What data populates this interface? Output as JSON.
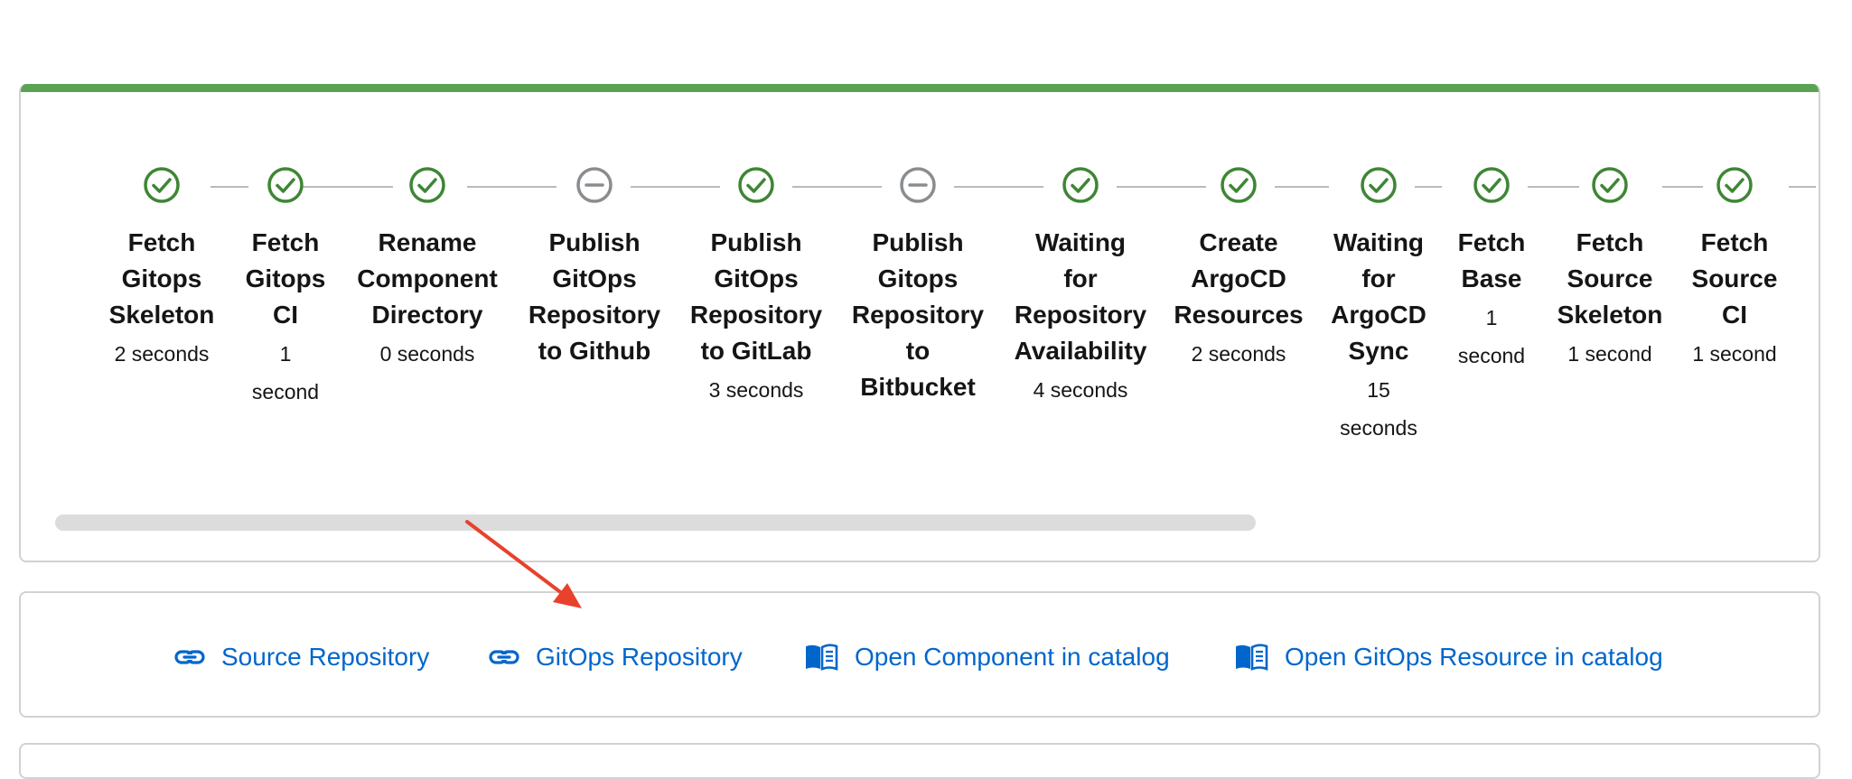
{
  "steps": [
    {
      "label": "Fetch\nGitops\nSkeleton",
      "duration": "2 seconds",
      "status": "success"
    },
    {
      "label": "Fetch\nGitops\nCI",
      "duration": "1\nsecond",
      "status": "success"
    },
    {
      "label": "Rename\nComponent\nDirectory",
      "duration": "0 seconds",
      "status": "success"
    },
    {
      "label": "Publish\nGitOps\nRepository\nto Github",
      "duration": "",
      "status": "skipped"
    },
    {
      "label": "Publish\nGitOps\nRepository\nto GitLab",
      "duration": "3 seconds",
      "status": "success"
    },
    {
      "label": "Publish\nGitops\nRepository\nto\nBitbucket",
      "duration": "",
      "status": "skipped"
    },
    {
      "label": "Waiting\nfor\nRepository\nAvailability",
      "duration": "4 seconds",
      "status": "success"
    },
    {
      "label": "Create\nArgoCD\nResources",
      "duration": "2 seconds",
      "status": "success"
    },
    {
      "label": "Waiting\nfor\nArgoCD\nSync",
      "duration": "15\nseconds",
      "status": "success"
    },
    {
      "label": "Fetch\nBase",
      "duration": "1\nsecond",
      "status": "success"
    },
    {
      "label": "Fetch\nSource\nSkeleton",
      "duration": "1 second",
      "status": "success"
    },
    {
      "label": "Fetch\nSource\nCI",
      "duration": "1 second",
      "status": "success"
    }
  ],
  "links": [
    {
      "label": "Source Repository",
      "icon": "link-icon"
    },
    {
      "label": "GitOps Repository",
      "icon": "link-icon"
    },
    {
      "label": "Open Component in catalog",
      "icon": "catalog-book-icon"
    },
    {
      "label": "Open GitOps Resource in catalog",
      "icon": "catalog-book-icon"
    }
  ],
  "colors": {
    "success": "#3e8635",
    "skipped": "#8a8d90",
    "progress_bar": "#5ba352",
    "link": "#0066cc",
    "annotation": "#e8412c"
  }
}
